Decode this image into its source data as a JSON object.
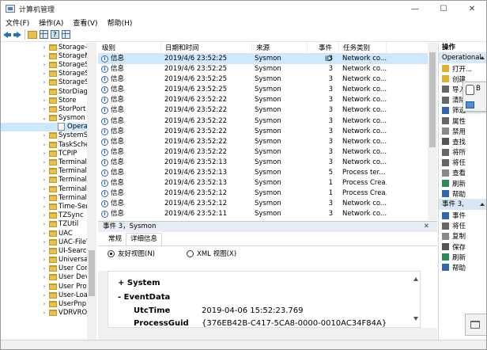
{
  "window": {
    "title": "计算机管理",
    "min": "—",
    "max": "☐",
    "close": "✕"
  },
  "menu": [
    "文件(F)",
    "操作(A)",
    "查看(V)",
    "帮助(H)"
  ],
  "tree": {
    "items": [
      "Storage-T",
      "StorageM",
      "StorageSp",
      "StorageSp",
      "StorageSp",
      "StorDiag",
      "Store",
      "StorPort",
      "Sysmon",
      "Opera",
      "SystemSe",
      "TaskSche",
      "TCPIP",
      "TerminalS",
      "TerminalS",
      "TerminalS",
      "TerminalS",
      "TerminalS",
      "Time-Sen",
      "TZSync",
      "TZUtil",
      "UAC",
      "UAC-FileV",
      "UI-Search",
      "UniversalT",
      "User Cont",
      "User Devi",
      "User Profi",
      "User-Loac",
      "UserPnp",
      "VDRVROC"
    ]
  },
  "list": {
    "headers": [
      "级别",
      "日期和时间",
      "来源",
      "事件 ID",
      "任务类别"
    ],
    "rows": [
      {
        "level": "信息",
        "dt": "2019/4/6 23:52:25",
        "src": "Sysmon",
        "id": "3",
        "cat": "Network co..."
      },
      {
        "level": "信息",
        "dt": "2019/4/6 23:52:25",
        "src": "Sysmon",
        "id": "3",
        "cat": "Network co..."
      },
      {
        "level": "信息",
        "dt": "2019/4/6 23:52:25",
        "src": "Sysmon",
        "id": "3",
        "cat": "Network co..."
      },
      {
        "level": "信息",
        "dt": "2019/4/6 23:52:25",
        "src": "Sysmon",
        "id": "3",
        "cat": "Network co..."
      },
      {
        "level": "信息",
        "dt": "2019/4/6 23:52:22",
        "src": "Sysmon",
        "id": "3",
        "cat": "Network co..."
      },
      {
        "level": "信息",
        "dt": "2019/4/6 23:52:22",
        "src": "Sysmon",
        "id": "3",
        "cat": "Network co..."
      },
      {
        "level": "信息",
        "dt": "2019/4/6 23:52:22",
        "src": "Sysmon",
        "id": "3",
        "cat": "Network co..."
      },
      {
        "level": "信息",
        "dt": "2019/4/6 23:52:22",
        "src": "Sysmon",
        "id": "3",
        "cat": "Network co..."
      },
      {
        "level": "信息",
        "dt": "2019/4/6 23:52:22",
        "src": "Sysmon",
        "id": "3",
        "cat": "Network co..."
      },
      {
        "level": "信息",
        "dt": "2019/4/6 23:52:22",
        "src": "Sysmon",
        "id": "3",
        "cat": "Network co..."
      },
      {
        "level": "信息",
        "dt": "2019/4/6 23:52:13",
        "src": "Sysmon",
        "id": "3",
        "cat": "Network co..."
      },
      {
        "level": "信息",
        "dt": "2019/4/6 23:52:13",
        "src": "Sysmon",
        "id": "5",
        "cat": "Process ter..."
      },
      {
        "level": "信息",
        "dt": "2019/4/6 23:52:13",
        "src": "Sysmon",
        "id": "1",
        "cat": "Process Crea..."
      },
      {
        "level": "信息",
        "dt": "2019/4/6 23:52:12",
        "src": "Sysmon",
        "id": "1",
        "cat": "Process Crea..."
      },
      {
        "level": "信息",
        "dt": "2019/4/6 23:52:12",
        "src": "Sysmon",
        "id": "3",
        "cat": "Network co..."
      },
      {
        "level": "信息",
        "dt": "2019/4/6 23:52:11",
        "src": "Sysmon",
        "id": "3",
        "cat": "Network co..."
      }
    ]
  },
  "detail": {
    "header": "事件 3，Sysmon",
    "close": "✕",
    "tabs": [
      "常规",
      "详细信息"
    ],
    "radio_friendly": "友好视图(N)",
    "radio_xml": "XML 视图(X)",
    "system": "+ System",
    "eventdata": "- EventData",
    "utc_label": "UtcTime",
    "utc_value": "2019-04-06 15:52:23.769",
    "guid_label": "ProcessGuid",
    "guid_value": "{376EB42B-C417-5CA8-0000-0010AC34F84A}"
  },
  "actions": {
    "title": "操作",
    "section1": "Operational",
    "items1": [
      "打开...",
      "创建",
      "导入",
      "清除",
      "筛选",
      "属性",
      "禁用",
      "查找",
      "将所",
      "将任",
      "查看",
      "刷新",
      "帮助"
    ],
    "section2": "事件 3,",
    "items2": [
      "事件",
      "将任",
      "复制",
      "保存",
      "刷新",
      "帮助"
    ],
    "popup_text": "B"
  }
}
